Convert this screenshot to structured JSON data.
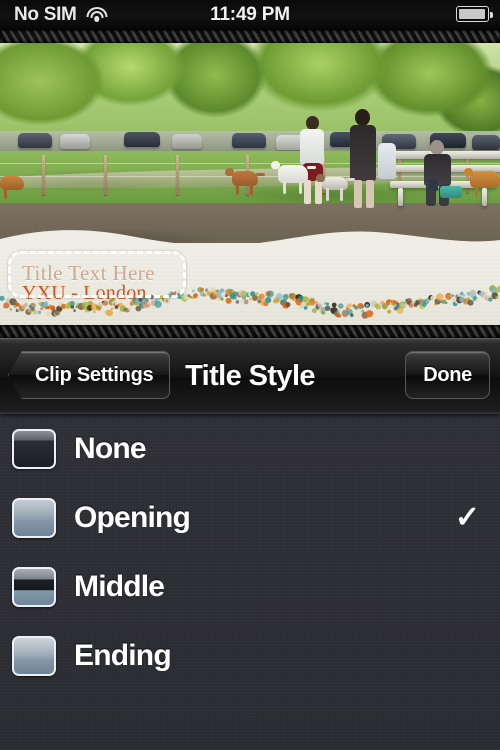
{
  "status_bar": {
    "carrier": "No SIM",
    "wifi_icon": "wifi-icon",
    "time": "11:49 PM",
    "battery_icon": "battery-icon"
  },
  "preview": {
    "scene_description": "dog park video frame with people and dogs",
    "title_overlay": {
      "title_placeholder": "Title Text Here",
      "subtitle": "YXU - London",
      "title_color": "#c9a995",
      "subtitle_color": "#d4521d",
      "selection_box": "dashed-selection-box"
    }
  },
  "navbar": {
    "back_label": "Clip Settings",
    "title": "Title Style",
    "done_label": "Done"
  },
  "list": {
    "selected": "Opening",
    "check_glyph": "✓",
    "items": [
      {
        "label": "None",
        "thumb": "thumb-none"
      },
      {
        "label": "Opening",
        "thumb": "thumb-opening"
      },
      {
        "label": "Middle",
        "thumb": "thumb-middle"
      },
      {
        "label": "Ending",
        "thumb": "thumb-ending"
      }
    ]
  },
  "theme": {
    "accent_orange": "#d4521d",
    "paper": "#efede5",
    "list_bg": "#2e2f35",
    "nav_bg": "#141414"
  }
}
